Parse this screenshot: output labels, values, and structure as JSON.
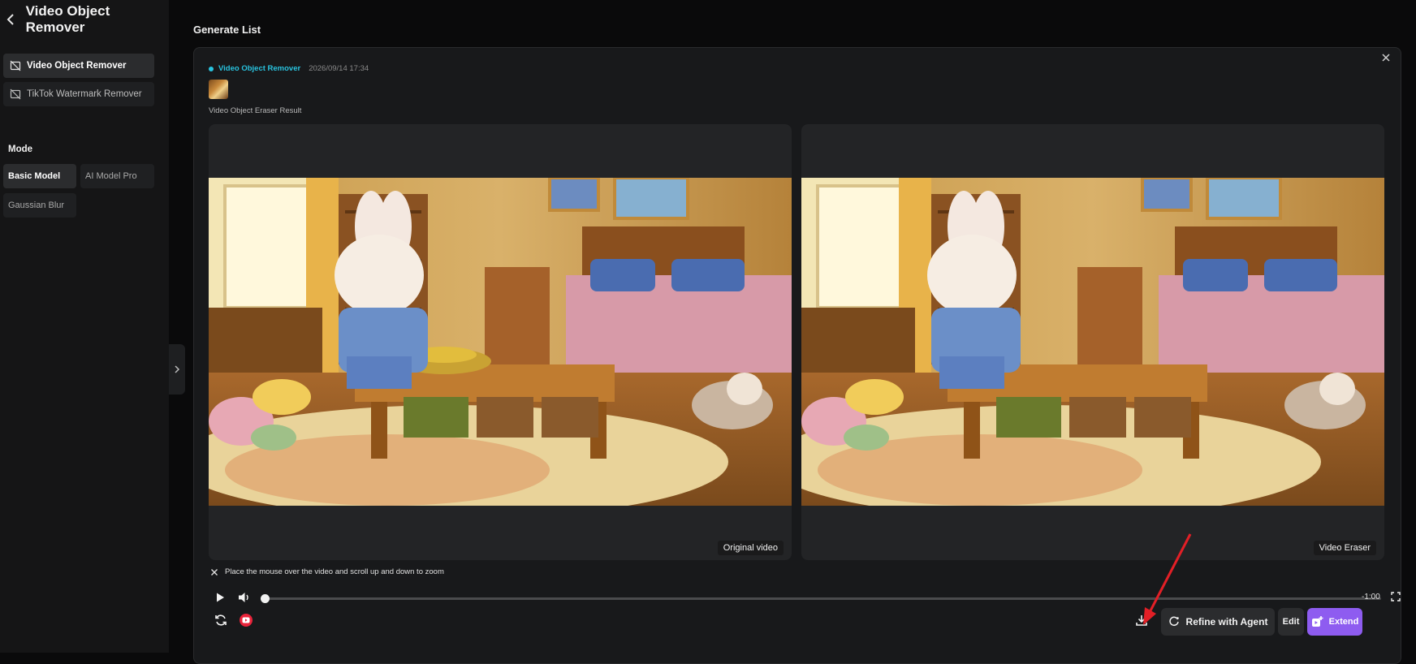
{
  "app": {
    "title": "Video Object Remover"
  },
  "sidebar": {
    "tools": [
      {
        "label": "Video Object Remover",
        "active": true
      },
      {
        "label": "TikTok Watermark Remover",
        "active": false
      }
    ],
    "mode_label": "Mode",
    "modes": [
      {
        "label": "Basic Model",
        "active": true
      },
      {
        "label": "AI Model Pro",
        "active": false
      },
      {
        "label": "Gaussian Blur",
        "active": false
      }
    ]
  },
  "main": {
    "section_title": "Generate List",
    "card": {
      "tool_tag": "Video Object Remover",
      "timestamp": "2026/09/14 17:34",
      "result_label": "Video Object Eraser Result",
      "left_badge": "Original video",
      "right_badge": "Video Eraser",
      "zoom_hint": "Place the mouse over the video and scroll up and down to zoom",
      "time_remaining": "-1:00",
      "progress_fraction": 0,
      "actions": {
        "refine": "Refine with Agent",
        "edit": "Edit",
        "extend": "Extend"
      }
    }
  },
  "colors": {
    "accent_cyan": "#29c4e0",
    "extend_purple": "#8e5cf0",
    "annotation_red": "#e21f26",
    "youtube_red": "#e8233a"
  },
  "icons": [
    "chevron-left-icon",
    "no-video-icon",
    "chevron-right-icon",
    "close-icon",
    "play-icon",
    "volume-icon",
    "fullscreen-icon",
    "refresh-icon",
    "youtube-icon",
    "download-icon",
    "refine-icon",
    "extend-icon",
    "annotation-arrow"
  ]
}
